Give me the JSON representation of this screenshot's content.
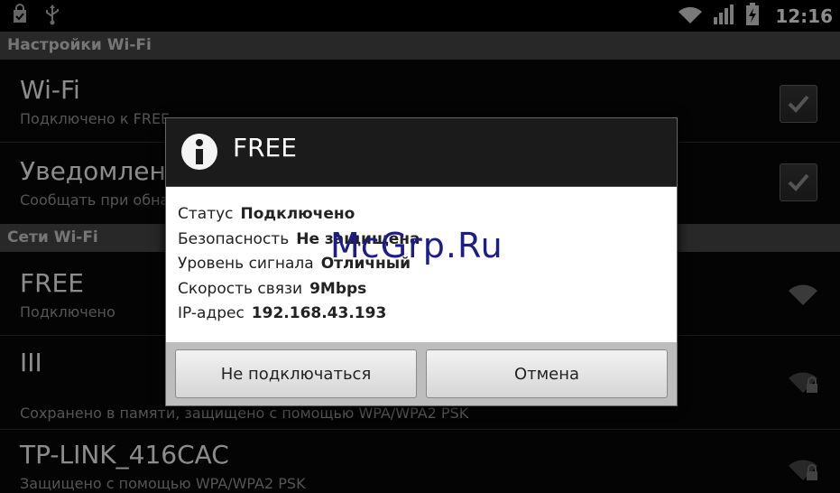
{
  "statusbar": {
    "time": "12:16",
    "left_icons": [
      "shopping-bag-icon",
      "usb-icon"
    ],
    "right_icons": [
      "wifi-signal-icon",
      "cell-signal-icon",
      "battery-charging-icon"
    ]
  },
  "sections": {
    "settings_header": "Настройки Wi-Fi",
    "networks_header": "Сети Wi-Fi"
  },
  "settings": [
    {
      "title": "Wi-Fi",
      "subtitle": "Подключено к FREE",
      "checked": true
    },
    {
      "title": "Уведомления о сетях",
      "subtitle": "Сообщать при обнаружении открытой сети",
      "checked": true
    }
  ],
  "networks": [
    {
      "ssid": "FREE",
      "status": "Подключено",
      "secured": false
    },
    {
      "ssid": "III",
      "status": "Сохранено в памяти, защищено с помощью WPA/WPA2 PSK",
      "secured": true
    },
    {
      "ssid": "TP-LINK_416CAC",
      "status": "Защищено с помощью WPA/WPA2 PSK",
      "secured": true
    }
  ],
  "dialog": {
    "icon": "info-icon",
    "title": "FREE",
    "rows": [
      {
        "label": "Статус",
        "value": "Подключено"
      },
      {
        "label": "Безопасность",
        "value": "Не защищена"
      },
      {
        "label": "Уровень сигнала",
        "value": "Отличный"
      },
      {
        "label": "Скорость связи",
        "value": "9Mbps"
      },
      {
        "label": "IP-адрес",
        "value": "192.168.43.193"
      }
    ],
    "buttons": {
      "forget": "Не подключаться",
      "cancel": "Отмена"
    }
  },
  "watermark": "McGrp.Ru"
}
